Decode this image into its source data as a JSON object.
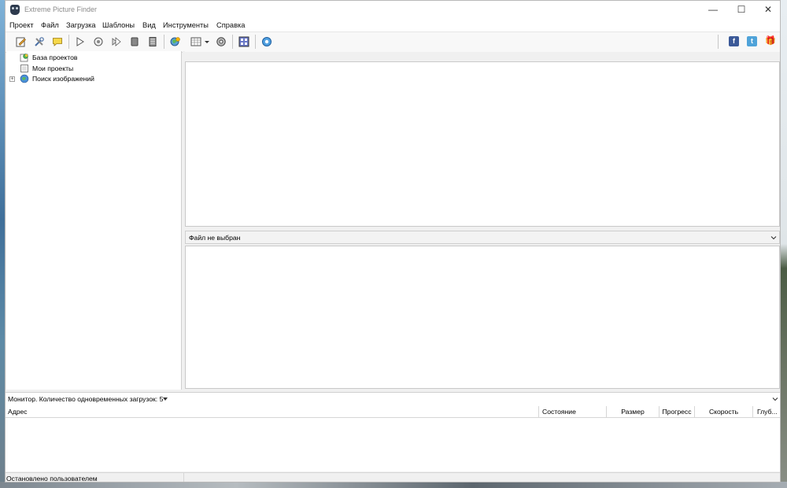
{
  "window": {
    "title": "Extreme Picture Finder",
    "controls": {
      "minimize": "—",
      "maximize": "☐",
      "close": "✕"
    }
  },
  "menu": [
    "Проект",
    "Файл",
    "Загрузка",
    "Шаблоны",
    "Вид",
    "Инструменты",
    "Справка"
  ],
  "toolbar": {
    "tools": [
      "new-project-icon",
      "project-properties-icon",
      "comment-icon",
      "start-icon",
      "pause-icon",
      "start-selected-icon",
      "stop-icon",
      "list-icon",
      "web-search-icon",
      "grid-view-icon",
      "settings-icon",
      "thumbnails-icon",
      "help-icon"
    ],
    "social": {
      "facebook": "f",
      "twitter": "t",
      "gift": "🎁"
    },
    "colors": {
      "facebook": "#3b5998",
      "twitter": "#4fa3d9",
      "gift": "#3b6fb0"
    }
  },
  "tree": {
    "items": [
      {
        "label": "База проектов",
        "icon": "projects-db-icon"
      },
      {
        "label": "Мои проекты",
        "icon": "my-projects-icon"
      },
      {
        "label": "Поиск изображений",
        "icon": "image-search-icon",
        "expander": "+"
      }
    ]
  },
  "preview": {
    "file_label": "Файл не выбран"
  },
  "monitor": {
    "label": "Монитор. Количество одновременных загрузок: 5"
  },
  "downloads": {
    "columns": [
      "Адрес",
      "Состояние",
      "Размер",
      "Прогресс",
      "Скорость",
      "Глуб..."
    ]
  },
  "status": {
    "text": "Остановлено пользователем"
  }
}
